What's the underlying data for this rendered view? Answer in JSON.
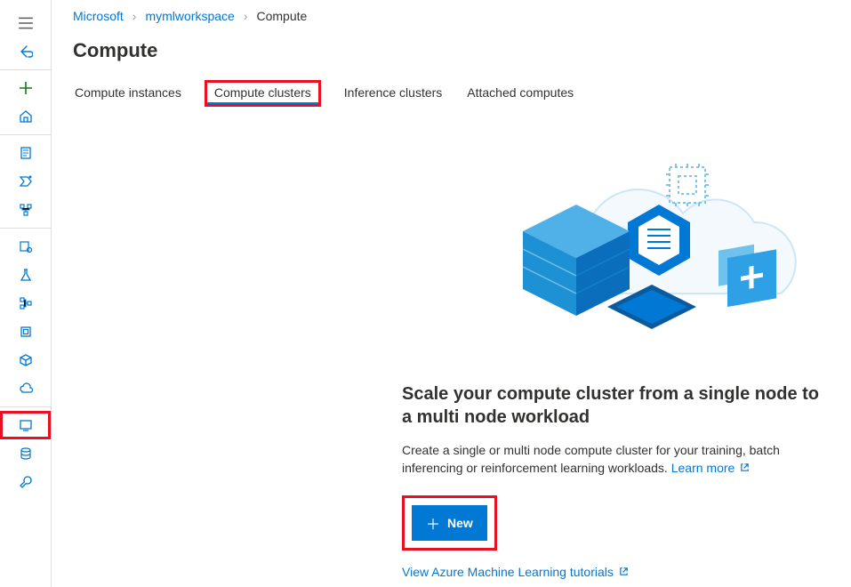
{
  "breadcrumb": {
    "items": [
      "Microsoft",
      "mymlworkspace"
    ],
    "current": "Compute"
  },
  "page_title": "Compute",
  "tabs": {
    "instances": "Compute instances",
    "clusters": "Compute clusters",
    "inference": "Inference clusters",
    "attached": "Attached computes"
  },
  "content": {
    "headline": "Scale your compute cluster from a single node to a multi node workload",
    "description": "Create a single or multi node compute cluster for your training, batch inferencing or reinforcement learning workloads.",
    "learn_more": "Learn more",
    "new_button": "New",
    "tutorials_link": "View Azure Machine Learning tutorials"
  },
  "sidebar": {
    "menu": "menu",
    "back": "back",
    "add": "add",
    "home": "home",
    "notebooks": "notebooks",
    "automl": "automl",
    "designer": "designer",
    "datasets": "datasets",
    "experiments": "experiments",
    "pipelines": "pipelines",
    "models": "models",
    "endpoints": "endpoints",
    "compute": "compute",
    "datastores": "datastores",
    "environments": "environments"
  }
}
